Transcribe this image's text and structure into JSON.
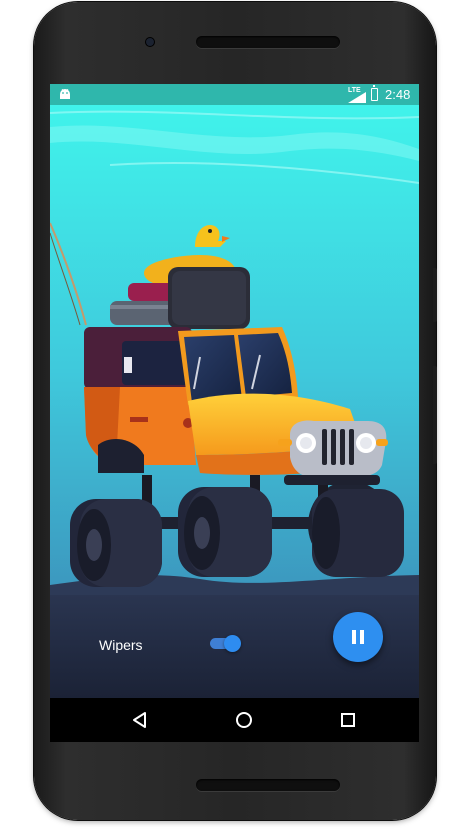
{
  "status_bar": {
    "network": "LTE",
    "time": "2:48"
  },
  "controls": {
    "wipers_label": "Wipers",
    "wipers_on": true,
    "play_state": "playing",
    "fab_icon": "pause-icon"
  },
  "nav_bar": {
    "back_icon": "back-triangle-icon",
    "home_icon": "home-circle-icon",
    "recents_icon": "recents-square-icon"
  },
  "colors": {
    "status_bar": "#2fb7ac",
    "sky_top": "#3ff2ea",
    "sky_bottom": "#3a8bb8",
    "ground": "#232b3f",
    "accent": "#2e8ff0",
    "car_body": "#f07a1e"
  }
}
